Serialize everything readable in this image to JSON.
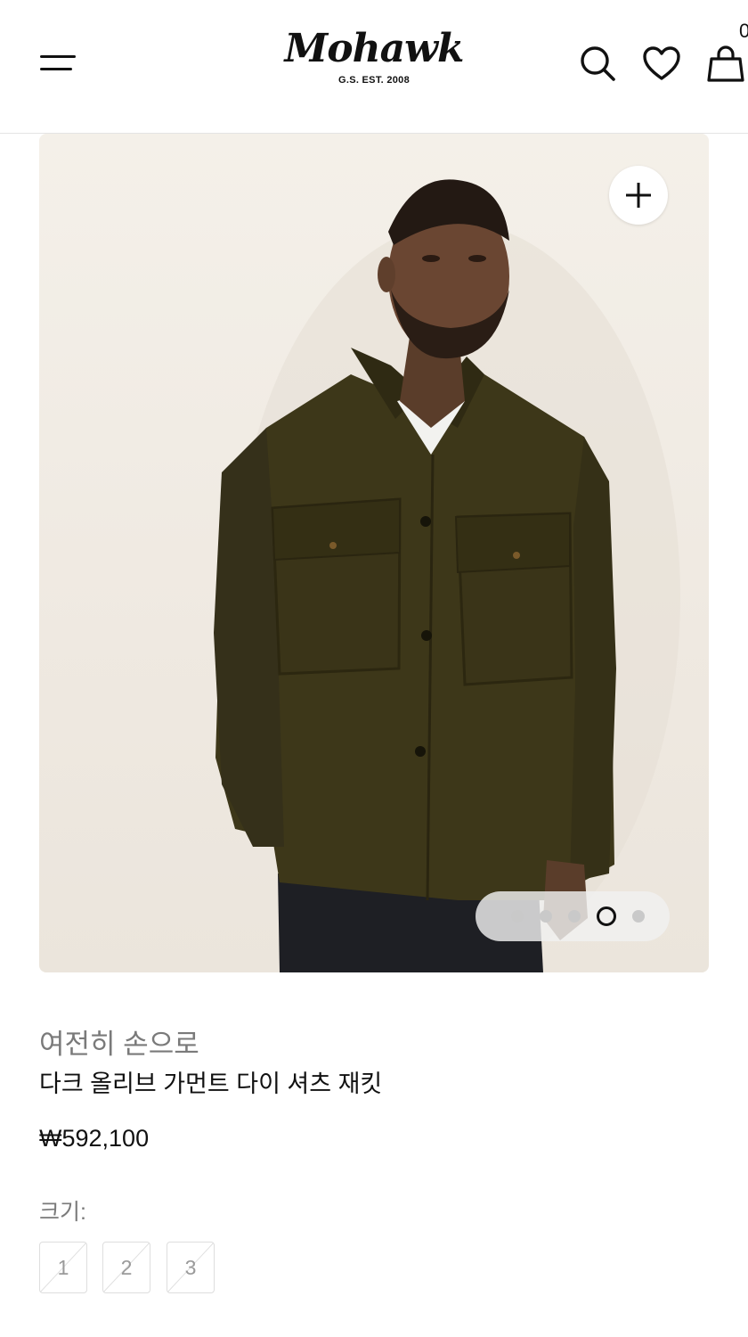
{
  "header": {
    "logo_text": "Mohawk",
    "logo_sub": "G.S. EST. 2008",
    "bag_count": "0",
    "icons": [
      "menu-icon",
      "search-icon",
      "heart-icon",
      "bag-icon"
    ]
  },
  "gallery": {
    "zoom_icon": "plus-icon",
    "slide_count": 5,
    "active_slide": 4,
    "image_subject": "model wearing dark olive shirt jacket"
  },
  "product": {
    "brand": "여전히 손으로",
    "title": "다크 올리브 가먼트 다이 셔츠 재킷",
    "price": "₩592,100"
  },
  "size": {
    "label": "크기:",
    "options": [
      "1",
      "2",
      "3"
    ],
    "unavailable": true
  },
  "colors": {
    "jacket": "#3b3417",
    "background": "#f1ece4",
    "muted_text": "#7a7a7a"
  }
}
